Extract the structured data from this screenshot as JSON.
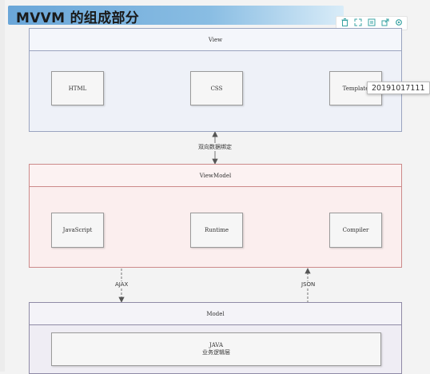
{
  "title": "MVVM 的组成部分",
  "toolbar": {
    "icons": [
      "trash-icon",
      "expand-icon",
      "copy-icon",
      "export-icon",
      "settings-icon"
    ]
  },
  "view": {
    "label": "View",
    "boxes": [
      "HTML",
      "CSS",
      "Template"
    ]
  },
  "binding_label": "双向数据绑定",
  "viewmodel": {
    "label": "ViewModel",
    "boxes": [
      "JavaScript",
      "Runtime",
      "Compiler"
    ]
  },
  "connectors": {
    "left": "AJAX",
    "right": "JSON"
  },
  "model": {
    "label": "Model",
    "box_line1": "JAVA",
    "box_line2": "业务逻辑层"
  },
  "tooltip": "20191017111"
}
